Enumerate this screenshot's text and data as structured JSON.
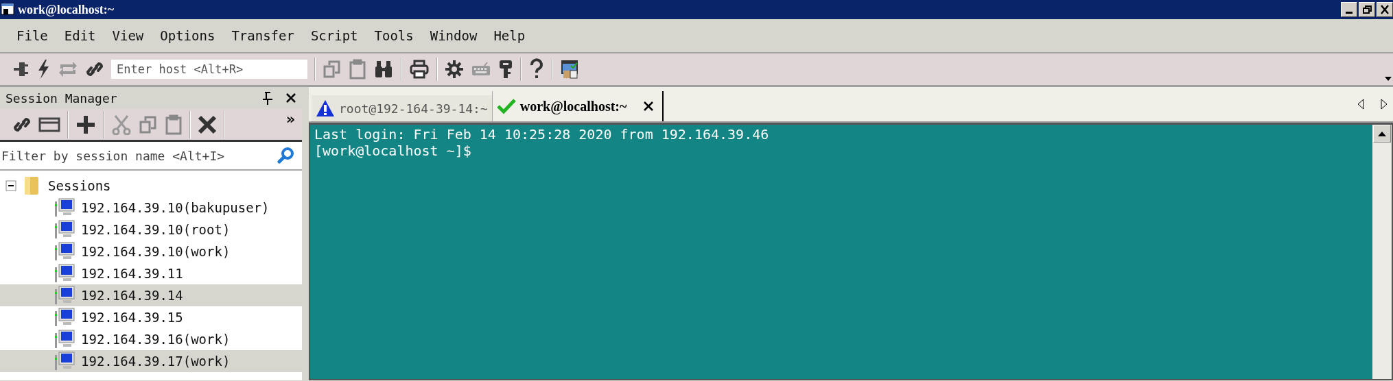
{
  "window": {
    "title": "work@localhost:~"
  },
  "menu": [
    "File",
    "Edit",
    "View",
    "Options",
    "Transfer",
    "Script",
    "Tools",
    "Window",
    "Help"
  ],
  "toolbar": {
    "host_field": {
      "placeholder": "Enter host <Alt+R>"
    }
  },
  "session_manager": {
    "title": "Session Manager",
    "overflow": "»",
    "filter": {
      "placeholder": "Filter by session name <Alt+I>"
    },
    "tree": [
      {
        "label": "Sessions",
        "expanded": true,
        "children": [
          {
            "label": "192.164.39.10(bakupuser)",
            "selected": false
          },
          {
            "label": "192.164.39.10(root)",
            "selected": false
          },
          {
            "label": "192.164.39.10(work)",
            "selected": false
          },
          {
            "label": "192.164.39.11",
            "selected": false
          },
          {
            "label": "192.164.39.14",
            "selected": true
          },
          {
            "label": "192.164.39.15",
            "selected": false
          },
          {
            "label": "192.164.39.16(work)",
            "selected": false
          },
          {
            "label": "192.164.39.17(work)",
            "selected": true
          }
        ]
      }
    ]
  },
  "tabs": [
    {
      "label": "root@192-164-39-14:~",
      "selected": false,
      "kind": "warning"
    },
    {
      "label": "work@localhost:~",
      "selected": true,
      "kind": "connected"
    }
  ],
  "terminal": {
    "lines": [
      "Last login: Fri Feb 14 10:25:28 2020 from 192.164.39.46",
      "[work@localhost ~]$"
    ]
  }
}
